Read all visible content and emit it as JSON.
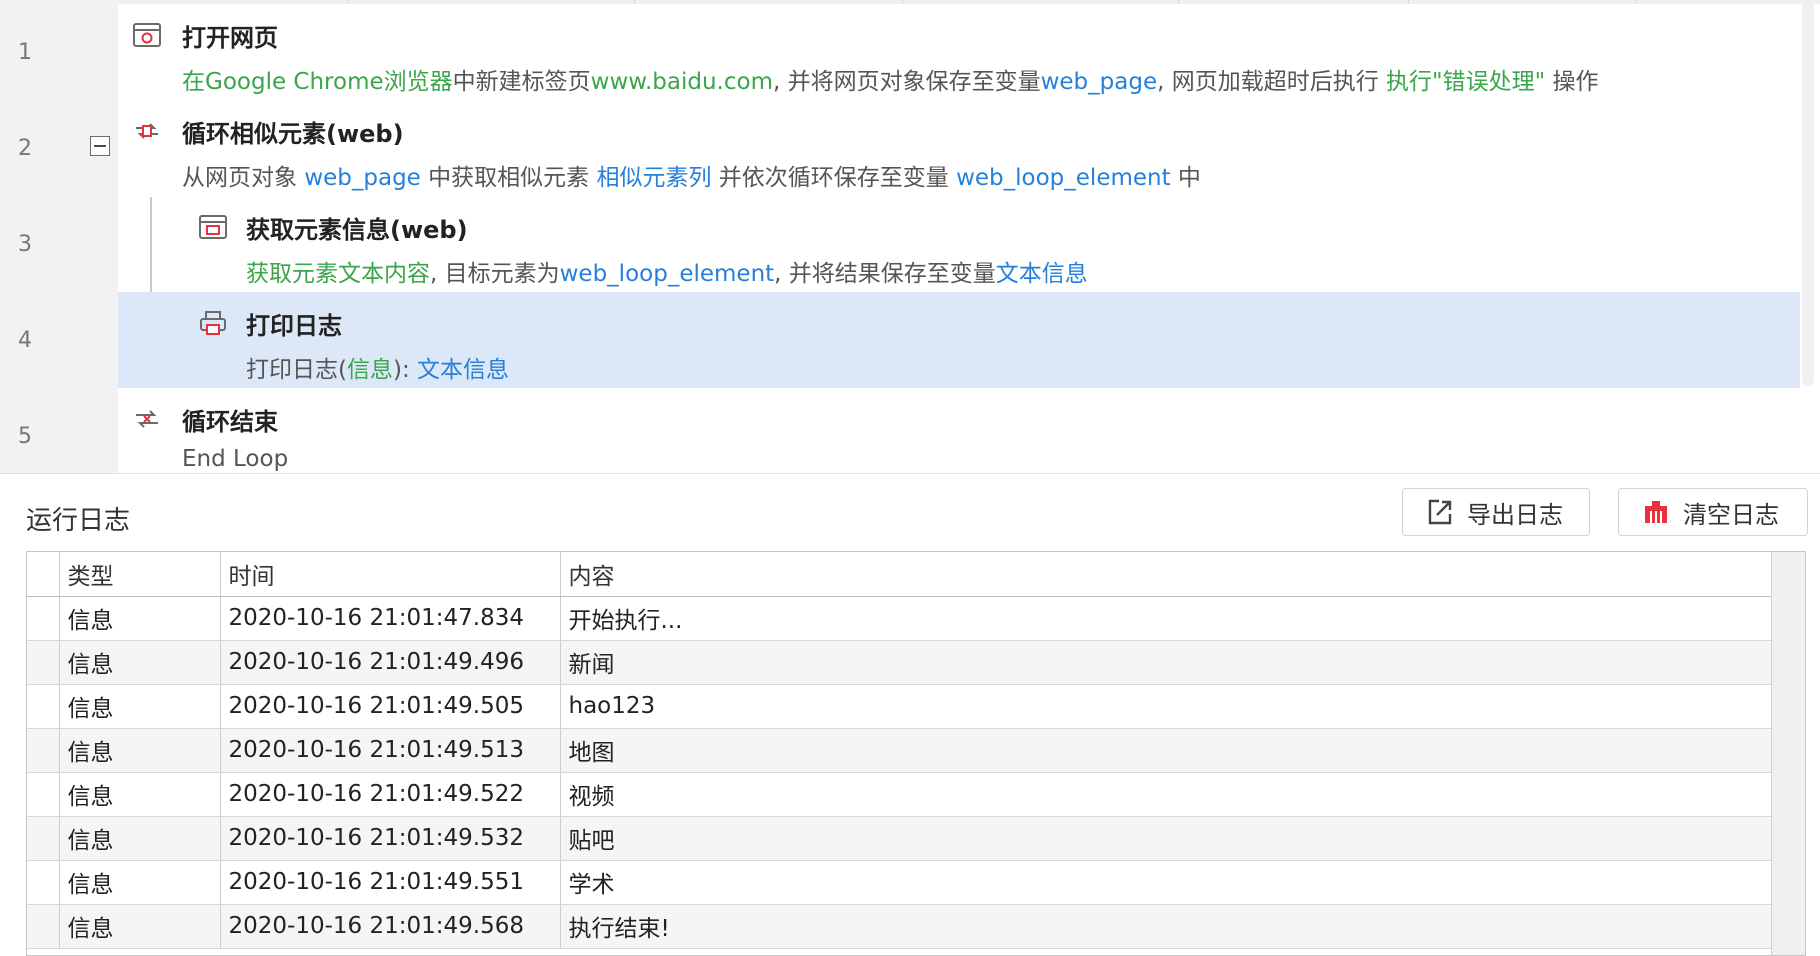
{
  "flow": {
    "steps": [
      {
        "line": "1",
        "title": "打开网页",
        "desc": [
          {
            "t": "在",
            "c": "g"
          },
          {
            "t": "Google Chrome浏览器",
            "c": "g"
          },
          {
            "t": "中新建标签页",
            "c": ""
          },
          {
            "t": "www.baidu.com",
            "c": "g"
          },
          {
            "t": ", 并将网页对象保存至变量",
            "c": ""
          },
          {
            "t": "web_page",
            "c": "b"
          },
          {
            "t": ", 网页加载超时后执行 ",
            "c": ""
          },
          {
            "t": "执行\"错误处理\"",
            "c": "g"
          },
          {
            "t": " 操作",
            "c": ""
          }
        ]
      },
      {
        "line": "2",
        "title": "循环相似元素(web)",
        "desc": [
          {
            "t": "从网页对象 ",
            "c": ""
          },
          {
            "t": "web_page",
            "c": "b"
          },
          {
            "t": " 中获取相似元素 ",
            "c": ""
          },
          {
            "t": "相似元素列",
            "c": "b"
          },
          {
            "t": " 并依次循环保存至变量 ",
            "c": ""
          },
          {
            "t": "web_loop_element",
            "c": "b"
          },
          {
            "t": " 中",
            "c": ""
          }
        ]
      },
      {
        "line": "3",
        "title": "获取元素信息(web)",
        "desc": [
          {
            "t": "获取元素文本内容",
            "c": "g"
          },
          {
            "t": ", 目标元素为",
            "c": ""
          },
          {
            "t": "web_loop_element",
            "c": "b"
          },
          {
            "t": ", 并将结果保存至变量",
            "c": ""
          },
          {
            "t": "文本信息",
            "c": "b"
          }
        ]
      },
      {
        "line": "4",
        "title": "打印日志",
        "desc": [
          {
            "t": "打印日志(",
            "c": ""
          },
          {
            "t": "信息",
            "c": "g"
          },
          {
            "t": "):  ",
            "c": ""
          },
          {
            "t": "文本信息",
            "c": "b"
          }
        ]
      },
      {
        "line": "5",
        "title": "循环结束",
        "desc": [
          {
            "t": "End Loop",
            "c": ""
          }
        ]
      }
    ]
  },
  "log": {
    "title": "运行日志",
    "export_label": "导出日志",
    "clear_label": "清空日志",
    "columns": {
      "type": "类型",
      "time": "时间",
      "content": "内容"
    },
    "rows": [
      {
        "type": "信息",
        "time": "2020-10-16 21:01:47.834",
        "content": "开始执行..."
      },
      {
        "type": "信息",
        "time": "2020-10-16 21:01:49.496",
        "content": "新闻"
      },
      {
        "type": "信息",
        "time": "2020-10-16 21:01:49.505",
        "content": "hao123"
      },
      {
        "type": "信息",
        "time": "2020-10-16 21:01:49.513",
        "content": "地图"
      },
      {
        "type": "信息",
        "time": "2020-10-16 21:01:49.522",
        "content": "视频"
      },
      {
        "type": "信息",
        "time": "2020-10-16 21:01:49.532",
        "content": "贴吧"
      },
      {
        "type": "信息",
        "time": "2020-10-16 21:01:49.551",
        "content": "学术"
      },
      {
        "type": "信息",
        "time": "2020-10-16 21:01:49.568",
        "content": "执行结束!"
      }
    ]
  },
  "colors": {
    "green_text": "#3aa54a",
    "blue_text": "#2680d9",
    "selected_row": "#dce8f7",
    "clear_icon": "#e5323e"
  },
  "icons": {
    "step1": "browser-open-icon",
    "step2": "loop-similar-icon",
    "step3": "element-info-icon",
    "step4": "print-log-icon",
    "step5": "loop-end-icon",
    "export": "export-icon",
    "clear": "clear-icon"
  }
}
